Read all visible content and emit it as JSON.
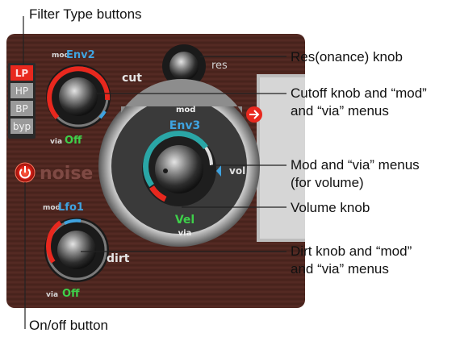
{
  "callouts": {
    "filter_type": "Filter Type buttons",
    "res_knob": "Res(onance) knob",
    "cutoff": [
      "Cutoff knob and “mod”",
      "and “via” menus"
    ],
    "mod_via_volume": [
      "Mod and “via” menus",
      "(for volume)"
    ],
    "volume_knob": "Volume knob",
    "dirt": [
      "Dirt knob and “mod”",
      "and “via” menus"
    ],
    "onoff": "On/off button"
  },
  "panel": {
    "filter_buttons": [
      "LP",
      "HP",
      "BP",
      "byp"
    ],
    "active_filter": "LP",
    "cut": {
      "mod_label": "mod",
      "mod_value": "Env2",
      "knob_label": "cut",
      "via_label": "via",
      "via_value": "Off"
    },
    "res": {
      "knob_label": "res"
    },
    "noise_label": "noise",
    "volume": {
      "mod_label": "mod",
      "mod_value": "Env3",
      "knob_label": "vol",
      "via_value": "Vel",
      "via_label": "via"
    },
    "dirt": {
      "mod_label": "mod",
      "mod_value": "Lfo1",
      "knob_label": "dirt",
      "via_label": "via",
      "via_value": "Off"
    }
  },
  "colors": {
    "panel_bg": "#4e2620",
    "accent_red": "#e8281e",
    "cyan_text": "#3fa3e0",
    "green_text": "#3ed04a",
    "teal_arc": "#2aa6a6"
  },
  "icons": [
    "power-icon",
    "arrow-right-icon"
  ]
}
